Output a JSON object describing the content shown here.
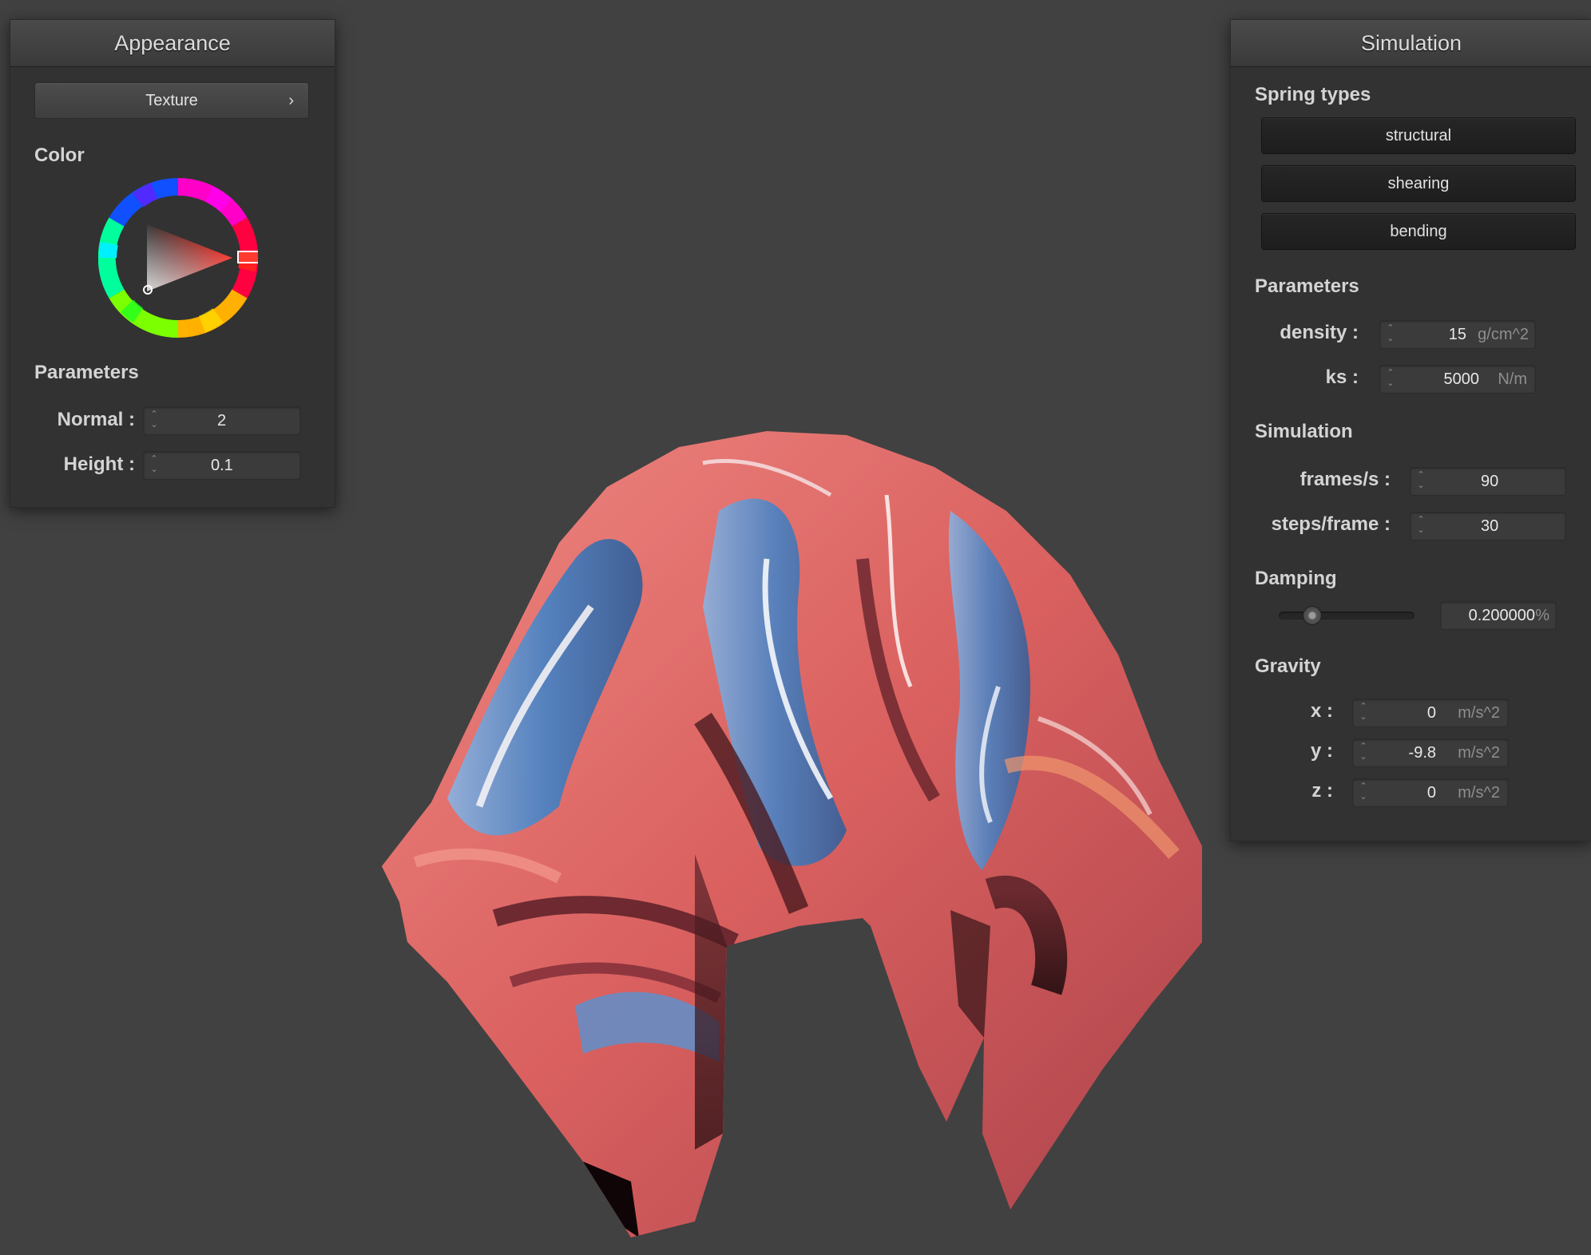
{
  "appearance": {
    "title": "Appearance",
    "texture_button": "Texture",
    "chevron_glyph": "›",
    "color_label": "Color",
    "selected_color": "#ff2d20",
    "parameters_label": "Parameters",
    "normal": {
      "label": "Normal :",
      "value": "2"
    },
    "height": {
      "label": "Height :",
      "value": "0.1"
    }
  },
  "simulation": {
    "title": "Simulation",
    "spring_types_label": "Spring types",
    "spring_buttons": [
      "structural",
      "shearing",
      "bending"
    ],
    "parameters_label": "Parameters",
    "density": {
      "label": "density :",
      "value": "15",
      "unit": "g/cm^2"
    },
    "ks": {
      "label": "ks :",
      "value": "5000",
      "unit": "N/m"
    },
    "simulation_label": "Simulation",
    "frames_per_s": {
      "label": "frames/s :",
      "value": "90"
    },
    "steps_per_frame": {
      "label": "steps/frame :",
      "value": "30"
    },
    "damping_label": "Damping",
    "damping": {
      "value": "0.200000",
      "unit": "%",
      "slider_fraction": 0.2
    },
    "gravity_label": "Gravity",
    "gravity": [
      {
        "label": "x :",
        "value": "0",
        "unit": "m/s^2"
      },
      {
        "label": "y :",
        "value": "-9.8",
        "unit": "m/s^2"
      },
      {
        "label": "z :",
        "value": "0",
        "unit": "m/s^2"
      }
    ]
  },
  "colors": {
    "background": "#414141",
    "panel": "#323232",
    "cloth_pink": "#e8746f",
    "cloth_blue": "#4f86c6",
    "cloth_dark": "#3a1418"
  }
}
